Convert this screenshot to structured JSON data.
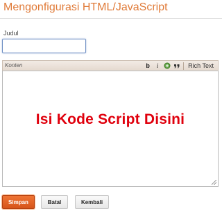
{
  "page": {
    "title": "Mengonfigurasi HTML/JavaScript"
  },
  "form": {
    "title_label": "Judul",
    "title_value": "",
    "content_label": "Konten",
    "rich_text_label": "Rich Text",
    "content_overlay": "Isi Kode Script Disini"
  },
  "toolbar": {
    "bold_label": "b",
    "italic_label": "i",
    "icons": [
      "bold-icon",
      "italic-icon",
      "link-icon",
      "quote-icon"
    ]
  },
  "buttons": {
    "save_label": "Simpan",
    "cancel_label": "Batal",
    "back_label": "Kembali"
  },
  "colors": {
    "title": "#e07b39",
    "overlay_text": "#e0000d",
    "save_button": "#e2631f"
  }
}
